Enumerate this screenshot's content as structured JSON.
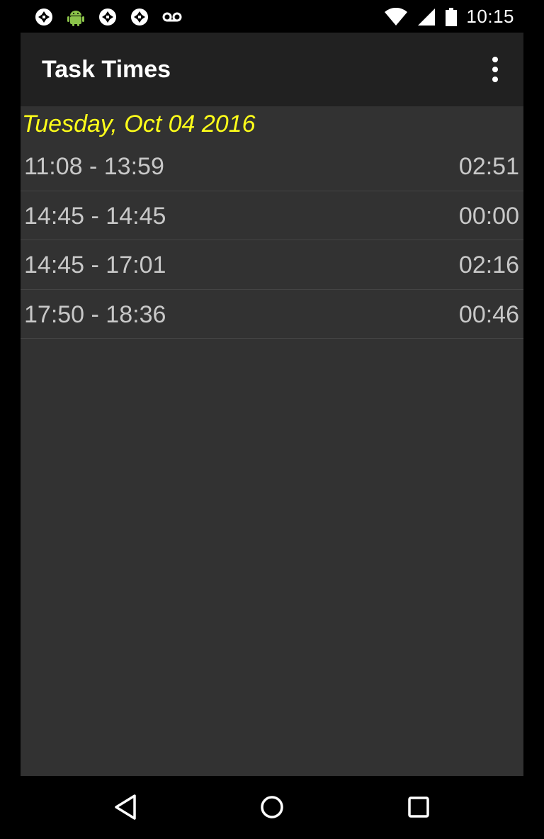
{
  "status_bar": {
    "time": "10:15",
    "left_icons": [
      "aperture-icon",
      "android-icon",
      "aperture-icon",
      "aperture-icon",
      "voicemail-icon"
    ],
    "right_icons": [
      "wifi-icon",
      "signal-icon",
      "battery-icon"
    ]
  },
  "app_bar": {
    "title": "Task Times",
    "menu_icon": "overflow-menu-icon"
  },
  "date_header": "Tuesday, Oct 04 2016",
  "entries": [
    {
      "range": "11:08 - 13:59",
      "duration": "02:51"
    },
    {
      "range": "14:45 - 14:45",
      "duration": "00:00"
    },
    {
      "range": "14:45 - 17:01",
      "duration": "02:16"
    },
    {
      "range": "17:50 - 18:36",
      "duration": "00:46"
    }
  ],
  "nav_bar": {
    "icons": [
      "back-icon",
      "home-icon",
      "recents-icon"
    ]
  },
  "colors": {
    "app_bar_bg": "#212121",
    "content_bg": "#323232",
    "date_accent": "#ffff1a",
    "row_text": "#c8c8c8",
    "android_green": "#8bc34a"
  }
}
